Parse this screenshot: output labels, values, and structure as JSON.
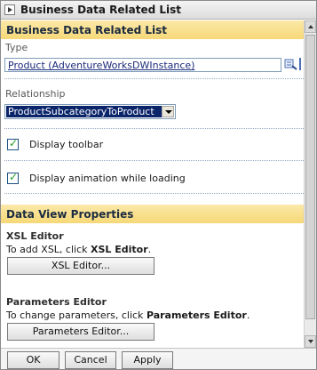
{
  "window": {
    "title": "Business Data Related List"
  },
  "section1": {
    "header": "Business Data Related List",
    "type_label": "Type",
    "type_value": "Product (AdventureWorksDWInstance)",
    "relationship_label": "Relationship",
    "relationship_value": "ProductSubcategoryToProduct",
    "display_toolbar_label": "Display toolbar",
    "display_toolbar_checked": true,
    "display_animation_label": "Display animation while loading",
    "display_animation_checked": true
  },
  "section2": {
    "header": "Data View Properties",
    "xsl": {
      "title": "XSL Editor",
      "desc_prefix": "To add XSL, click ",
      "desc_bold": "XSL Editor",
      "desc_suffix": ".",
      "button": "XSL Editor..."
    },
    "params": {
      "title": "Parameters Editor",
      "desc_prefix": "To change parameters, click ",
      "desc_bold": "Parameters Editor",
      "desc_suffix": ".",
      "button": "Parameters Editor..."
    }
  },
  "footer": {
    "ok": "OK",
    "cancel": "Cancel",
    "apply": "Apply"
  },
  "colors": {
    "section_header": "#f7d878",
    "selection": "#0a246a",
    "link": "#1b2a7a"
  }
}
